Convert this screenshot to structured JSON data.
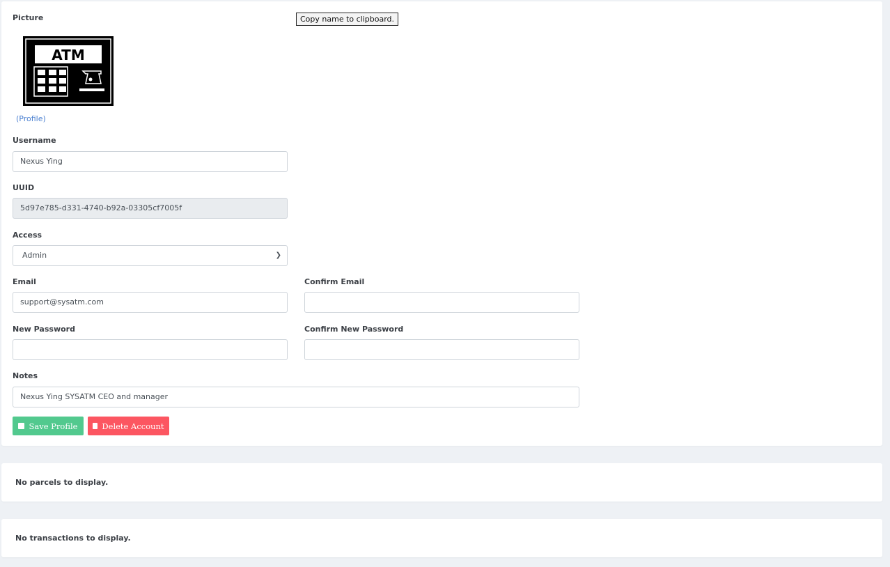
{
  "picture": {
    "label": "Picture",
    "image_text": "ATM",
    "profile_link": "(Profile)"
  },
  "tooltip": "Copy name to clipboard.",
  "username": {
    "label": "Username",
    "value": "Nexus Ying"
  },
  "uuid": {
    "label": "UUID",
    "value": "5d97e785-d331-4740-b92a-03305cf7005f"
  },
  "access": {
    "label": "Access",
    "value": "Admin"
  },
  "email": {
    "label": "Email",
    "value": "support@sysatm.com"
  },
  "confirm_email": {
    "label": "Confirm Email",
    "value": ""
  },
  "new_password": {
    "label": "New Password",
    "value": ""
  },
  "confirm_password": {
    "label": "Confirm New Password",
    "value": ""
  },
  "notes": {
    "label": "Notes",
    "value": "Nexus Ying SYSATM CEO and manager"
  },
  "buttons": {
    "save": "Save Profile",
    "delete": "Delete Account"
  },
  "colors": {
    "save": "#52c98e",
    "delete": "#fc5661",
    "link": "#4a7fd0"
  },
  "parcels_message": "No parcels to display.",
  "transactions_message": "No transactions to display."
}
